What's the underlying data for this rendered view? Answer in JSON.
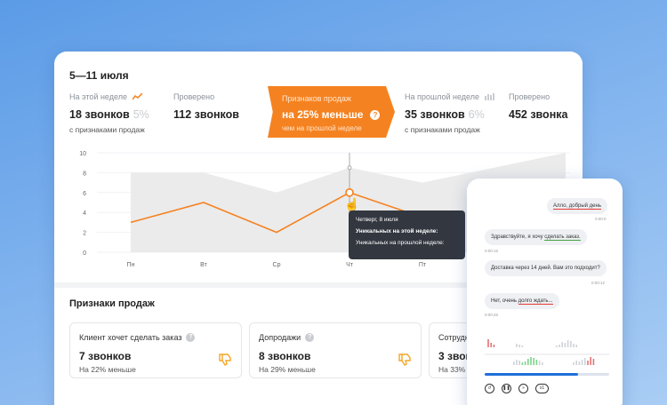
{
  "date_range": "5—11 июля",
  "stats": {
    "this_week": {
      "label": "На этой неделе",
      "value": "18 звонков",
      "pct": "5%",
      "sub": "с признаками продаж"
    },
    "checked_this": {
      "label": "Проверено",
      "value": "112 звонков"
    },
    "highlight": {
      "label": "Признаков продаж",
      "value": "на 25% меньше",
      "sub": "чем на прошлой неделе",
      "q": "?"
    },
    "last_week": {
      "label": "На прошлой неделе",
      "value": "35 звонков",
      "pct": "6%",
      "sub": "с признаками продаж"
    },
    "checked_last": {
      "label": "Проверено",
      "value": "452 звонка"
    }
  },
  "colors": {
    "accent": "#f58220",
    "area": "#ebebeb",
    "tooltip": "#333740",
    "progress": "#1e6fd9"
  },
  "chart_data": {
    "type": "line",
    "categories": [
      "Пн",
      "Вт",
      "Ср",
      "Чт",
      "Пт"
    ],
    "yticks": [
      0,
      2,
      4,
      6,
      8,
      10
    ],
    "ylim": [
      0,
      10
    ],
    "series": [
      {
        "values": [
          3,
          5,
          2,
          6,
          3.5
        ]
      },
      {
        "values": [
          8,
          8,
          6,
          8.5,
          7
        ]
      }
    ],
    "highlight_category": "Чт"
  },
  "tooltip": {
    "title": "Четверг, 8 июля",
    "line1": "Уникальных на этой неделе:",
    "line2": "Уникальных на прошлой неделе:"
  },
  "section_title": "Признаки продаж",
  "signs": [
    {
      "title": "Клиент хочет сделать заказ",
      "value": "7 звонков",
      "sub": "На 22% меньше"
    },
    {
      "title": "Допродажи",
      "value": "8 звонков",
      "sub": "На 29% меньше"
    },
    {
      "title": "Сотрудн",
      "value": "3 звонк",
      "sub": "На 33% м"
    }
  ],
  "dialog": {
    "m1": "Алло, добрый день",
    "t1": "0:00:0",
    "m2a": "Здравствуйте, я хочу ",
    "m2b": "сделать заказ.",
    "t2": "0:00:15",
    "m3": "Доставка через 14 дней. Вам это подходит?",
    "t3": "0:00:12",
    "m4a": "Нет, очень ",
    "m4b": "долго ждать...",
    "t4": "0:00:45",
    "speed": "x1",
    "progress": 0.75
  }
}
